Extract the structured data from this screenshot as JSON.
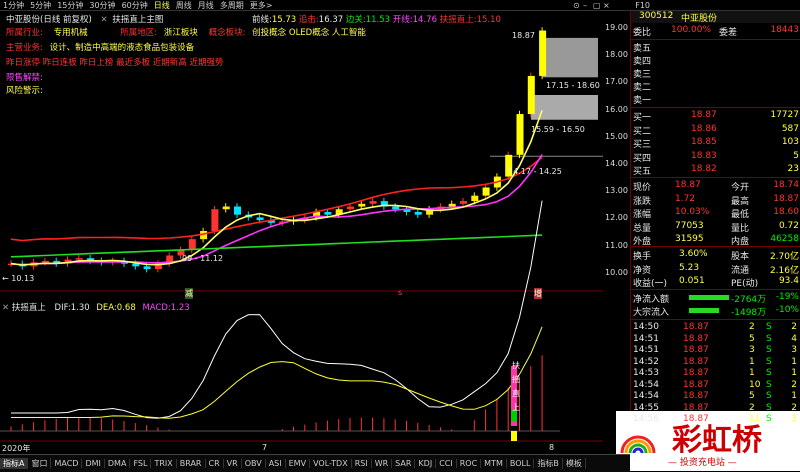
{
  "toolbar": {
    "tabs": [
      "1分钟",
      "5分钟",
      "15分钟",
      "30分钟",
      "60分钟",
      "日线",
      "周线",
      "月线",
      "多周期",
      "更多>"
    ],
    "active_tab": "日线",
    "f10": "F10"
  },
  "header": {
    "stock_title": "中亚股份(日线 前复权)",
    "indicator_tab": "扶摇直上主图",
    "labels": {
      "qianzhi_label": "前线:",
      "qianzhi": "15.73",
      "zhuigao_label": "追击:",
      "zhuigao": "16.37",
      "bianguan_label": "边关:",
      "bianguan": "11.53",
      "kaixian_label": "开线:",
      "kaixian": "14.76",
      "fyzs_label": "扶摇直上:",
      "fyzs": "15.10"
    }
  },
  "info_panel": {
    "industry": "所属行业:",
    "industry_val": "专用机械",
    "region": "所属地区:",
    "region_val": "浙江板块",
    "concept": "概念板块:",
    "concept_val": "创投概念 OLED概念 人工智能",
    "business": "主营业务:",
    "business_val": "设计、制造中高端的液态食品包装设备",
    "news": "昨日涨停 昨日连板 昨日上榜 最近多板 近期新高 近期强势",
    "unban": "限售解禁:",
    "risk": "风险警示:"
  },
  "chart_labels": {
    "high_label": "18.87",
    "box1": "17.15 - 18.60",
    "box2": "15.59 - 16.50",
    "box3": "14.17 - 14.25",
    "box_low": "09 - 11.12",
    "low_label": "10.13",
    "mark_jian": "减",
    "mark_s": "s",
    "mark_zeng": "增",
    "year": "2020年",
    "month7": "7",
    "month8": "8"
  },
  "yaxis": [
    "19.00",
    "18.00",
    "17.00",
    "16.00",
    "15.00",
    "14.00",
    "13.00",
    "12.00",
    "11.00",
    "10.00"
  ],
  "sub_header": {
    "name": "扶摇直上",
    "dif_label": "DIF:",
    "dif": "1.30",
    "dea_label": "DEA:",
    "dea": "0.68",
    "macd_label": "MACD:",
    "macd": "1.23",
    "sub_text": "扶 摇 直 上"
  },
  "sub_yaxis": {
    "top": "",
    "bottom": ""
  },
  "bottom_tabs": [
    "指标A",
    "窗口",
    "MACD",
    "DMI",
    "DMA",
    "FSL",
    "TRIX",
    "BRAR",
    "CR",
    "VR",
    "OBV",
    "ASI",
    "EMV",
    "VOL-TDX",
    "RSI",
    "WR",
    "SAR",
    "KDJ",
    "CCI",
    "ROC",
    "MTM",
    "BOLL",
    "指标B",
    "模板"
  ],
  "right_panel": {
    "code": "300512",
    "name": "中亚股份",
    "weibi_label": "委比",
    "weibi": "100.00%",
    "weicha_label": "委差",
    "weicha": "18443",
    "sell": [
      {
        "label": "卖五",
        "price": "",
        "vol": ""
      },
      {
        "label": "卖四",
        "price": "",
        "vol": ""
      },
      {
        "label": "卖三",
        "price": "",
        "vol": ""
      },
      {
        "label": "卖二",
        "price": "",
        "vol": ""
      },
      {
        "label": "卖一",
        "price": "",
        "vol": ""
      }
    ],
    "buy": [
      {
        "label": "买一",
        "price": "18.87",
        "vol": "17727"
      },
      {
        "label": "买二",
        "price": "18.86",
        "vol": "587"
      },
      {
        "label": "买三",
        "price": "18.85",
        "vol": "103"
      },
      {
        "label": "买四",
        "price": "18.83",
        "vol": "5"
      },
      {
        "label": "买五",
        "price": "18.82",
        "vol": "23"
      }
    ],
    "stats": [
      {
        "l1": "现价",
        "v1": "18.87",
        "l2": "今开",
        "v2": "18.74"
      },
      {
        "l1": "涨跌",
        "v1": "1.72",
        "l2": "最高",
        "v2": "18.87"
      },
      {
        "l1": "涨幅",
        "v1": "10.03%",
        "l2": "最低",
        "v2": "18.60"
      },
      {
        "l1": "总量",
        "v1": "77053",
        "l2": "量比",
        "v2": "0.72"
      },
      {
        "l1": "外盘",
        "v1": "31595",
        "l2": "内盘",
        "v2": "46258"
      }
    ],
    "stats2": [
      {
        "l1": "换手",
        "v1": "3.60%",
        "l2": "股本",
        "v2": "2.70亿"
      },
      {
        "l1": "净资",
        "v1": "5.23",
        "l2": "流通",
        "v2": "2.16亿"
      },
      {
        "l1": "收益(一)",
        "v1": "0.051",
        "l2": "PE(动)",
        "v2": "93.4"
      }
    ],
    "flow": [
      {
        "label": "净流入额",
        "val": "-2764万",
        "pct": "-19%"
      },
      {
        "label": "大宗流入",
        "val": "-1498万",
        "pct": "-10%"
      }
    ],
    "ticks": [
      {
        "t": "14:50",
        "p": "18.87",
        "v": "2",
        "bs": "S",
        "n": "2"
      },
      {
        "t": "14:51",
        "p": "18.87",
        "v": "5",
        "bs": "S",
        "n": "4"
      },
      {
        "t": "14:51",
        "p": "18.87",
        "v": "3",
        "bs": "S",
        "n": "3"
      },
      {
        "t": "14:52",
        "p": "18.87",
        "v": "1",
        "bs": "S",
        "n": "1"
      },
      {
        "t": "14:53",
        "p": "18.87",
        "v": "1",
        "bs": "S",
        "n": "1"
      },
      {
        "t": "14:54",
        "p": "18.87",
        "v": "10",
        "bs": "S",
        "n": "2"
      },
      {
        "t": "14:54",
        "p": "18.87",
        "v": "5",
        "bs": "S",
        "n": "1"
      },
      {
        "t": "14:55",
        "p": "18.87",
        "v": "2",
        "bs": "S",
        "n": "2"
      },
      {
        "t": "14:56",
        "p": "18.87",
        "v": "11",
        "bs": "S",
        "n": "3"
      }
    ],
    "logo_text": "彩虹桥",
    "logo_sub": "— 投资充电站 —"
  },
  "colors": {
    "up": "#ff3333",
    "down": "#00ffff",
    "ma_yellow": "#ffff00",
    "ma_magenta": "#ff33ff",
    "ma_red": "#ff2020",
    "ma_green": "#22dd22"
  }
}
